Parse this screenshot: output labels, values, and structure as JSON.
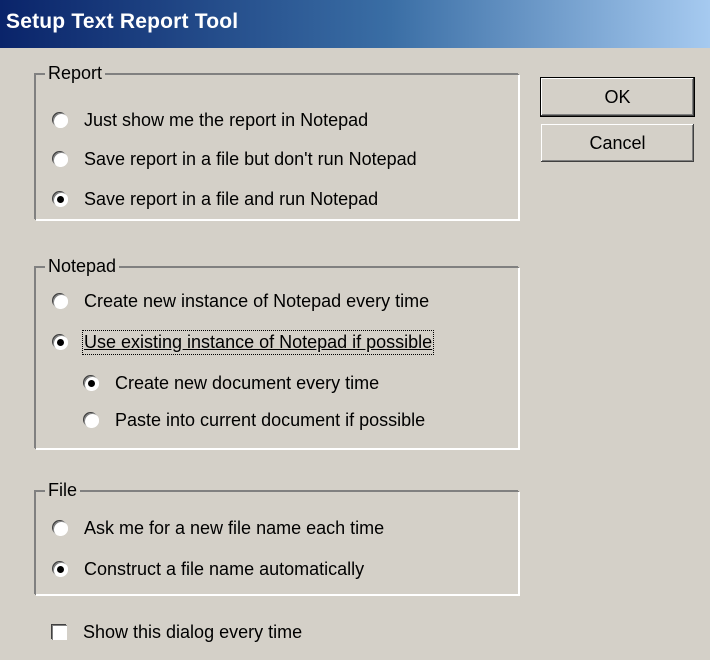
{
  "window": {
    "title": "Setup Text Report Tool"
  },
  "buttons": {
    "ok": "OK",
    "cancel": "Cancel"
  },
  "report": {
    "legend": "Report",
    "options": [
      {
        "label": "Just show me the report in Notepad",
        "checked": false
      },
      {
        "label": "Save report in a file but don't run Notepad",
        "checked": false
      },
      {
        "label": "Save report in a file and run Notepad",
        "checked": true
      }
    ]
  },
  "notepad": {
    "legend": "Notepad",
    "options": [
      {
        "label": "Create new instance of Notepad every time",
        "checked": false
      },
      {
        "label": "Use existing instance of Notepad if possible",
        "checked": true
      }
    ],
    "sub_options": [
      {
        "label": "Create new document every time",
        "checked": true
      },
      {
        "label": "Paste into current document if possible",
        "checked": false
      }
    ]
  },
  "file": {
    "legend": "File",
    "options": [
      {
        "label": "Ask me for a new file name each time",
        "checked": false
      },
      {
        "label": "Construct a file name automatically",
        "checked": true
      }
    ]
  },
  "show_dialog": {
    "label": "Show this dialog every time",
    "checked": false
  }
}
